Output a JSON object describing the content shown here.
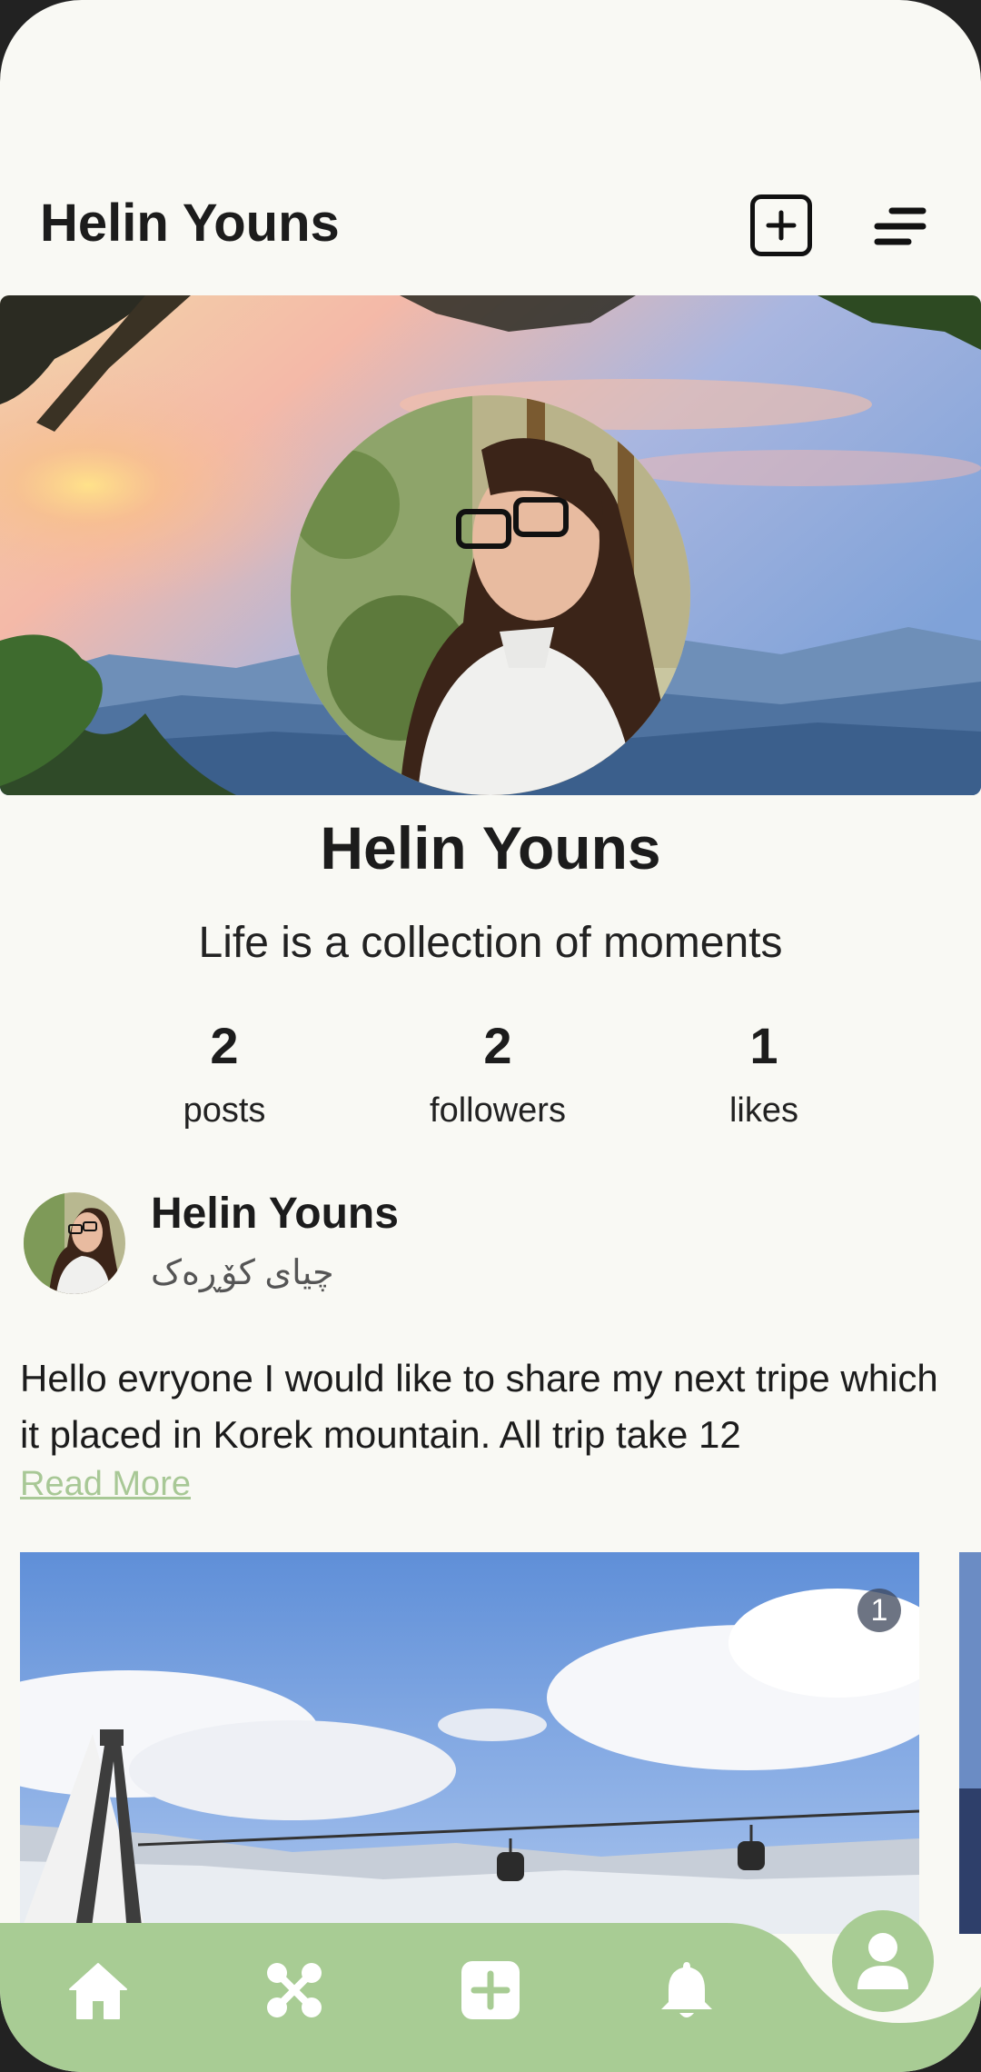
{
  "header": {
    "title": "Helin Youns",
    "icons": [
      "add-post-icon",
      "menu-icon"
    ]
  },
  "profile": {
    "name": "Helin Youns",
    "bio": "Life is a collection of moments",
    "stats": [
      {
        "value": "2",
        "label": "posts"
      },
      {
        "value": "2",
        "label": "followers"
      },
      {
        "value": "1",
        "label": "likes"
      }
    ]
  },
  "post": {
    "author": "Helin Youns",
    "location": "چیای کۆڕەک",
    "text": "Hello evryone I would like to share my next tripe which it placed in Korek mountain. All trip take 12",
    "read_more": "Read More",
    "image_counter": "1"
  },
  "nav": {
    "items": [
      "home-icon",
      "hub-icon",
      "add-icon",
      "bell-icon",
      "profile-icon"
    ]
  },
  "colors": {
    "accent": "#a8cc94",
    "background": "#f9f9f4",
    "text": "#1c1c1c"
  }
}
